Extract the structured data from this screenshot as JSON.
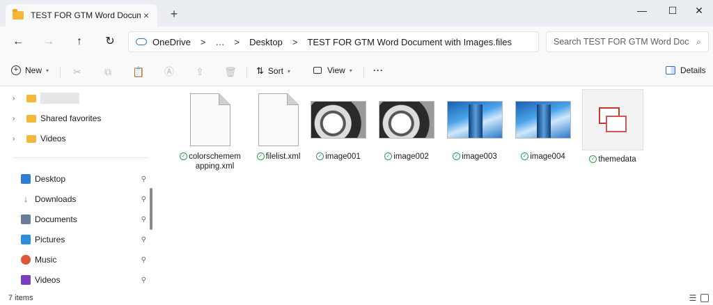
{
  "window": {
    "tab_title": "TEST FOR GTM Word Docume",
    "tab_close": "×",
    "new_tab": "+",
    "minimize": "—",
    "maximize": "☐",
    "close": "✕"
  },
  "nav": {
    "back": "←",
    "forward": "→",
    "up": "↑",
    "refresh": "↻",
    "breadcrumb": [
      "OneDrive",
      "…",
      "Desktop",
      "TEST FOR GTM Word Document with Images.files"
    ],
    "separator": ">",
    "search_placeholder": "Search TEST FOR GTM Word Doc",
    "search_icon": "⌕"
  },
  "toolbar": {
    "new_label": "New",
    "sort_label": "Sort",
    "view_label": "View",
    "more_label": "···",
    "details_label": "Details"
  },
  "sidebar": {
    "tree": [
      {
        "label": ""
      },
      {
        "label": "Shared favorites"
      },
      {
        "label": "Videos"
      }
    ],
    "quick_access": [
      {
        "label": "Desktop",
        "icon": "desktop-icon",
        "color": "#2f7fd1"
      },
      {
        "label": "Downloads",
        "icon": "download-icon",
        "color": "#2f7fd1"
      },
      {
        "label": "Documents",
        "icon": "documents-icon",
        "color": "#6b7c99"
      },
      {
        "label": "Pictures",
        "icon": "pictures-icon",
        "color": "#2f8de0"
      },
      {
        "label": "Music",
        "icon": "music-icon",
        "color": "#e0533d"
      },
      {
        "label": "Videos",
        "icon": "videos-icon",
        "color": "#7b3fbd"
      }
    ],
    "pin": "📌"
  },
  "files": [
    {
      "name": "colorschememapping.xml",
      "kind": "doc"
    },
    {
      "name": "filelist.xml",
      "kind": "doc"
    },
    {
      "name": "image001",
      "kind": "stair"
    },
    {
      "name": "image002",
      "kind": "stair"
    },
    {
      "name": "image003",
      "kind": "sky"
    },
    {
      "name": "image004",
      "kind": "sky"
    },
    {
      "name": "themedata",
      "kind": "theme"
    }
  ],
  "status": {
    "item_count": "7 items"
  },
  "colors": {
    "accent": "#2e6fbf",
    "sync_ok": "#2e9b4f",
    "folder": "#f3b83b"
  }
}
